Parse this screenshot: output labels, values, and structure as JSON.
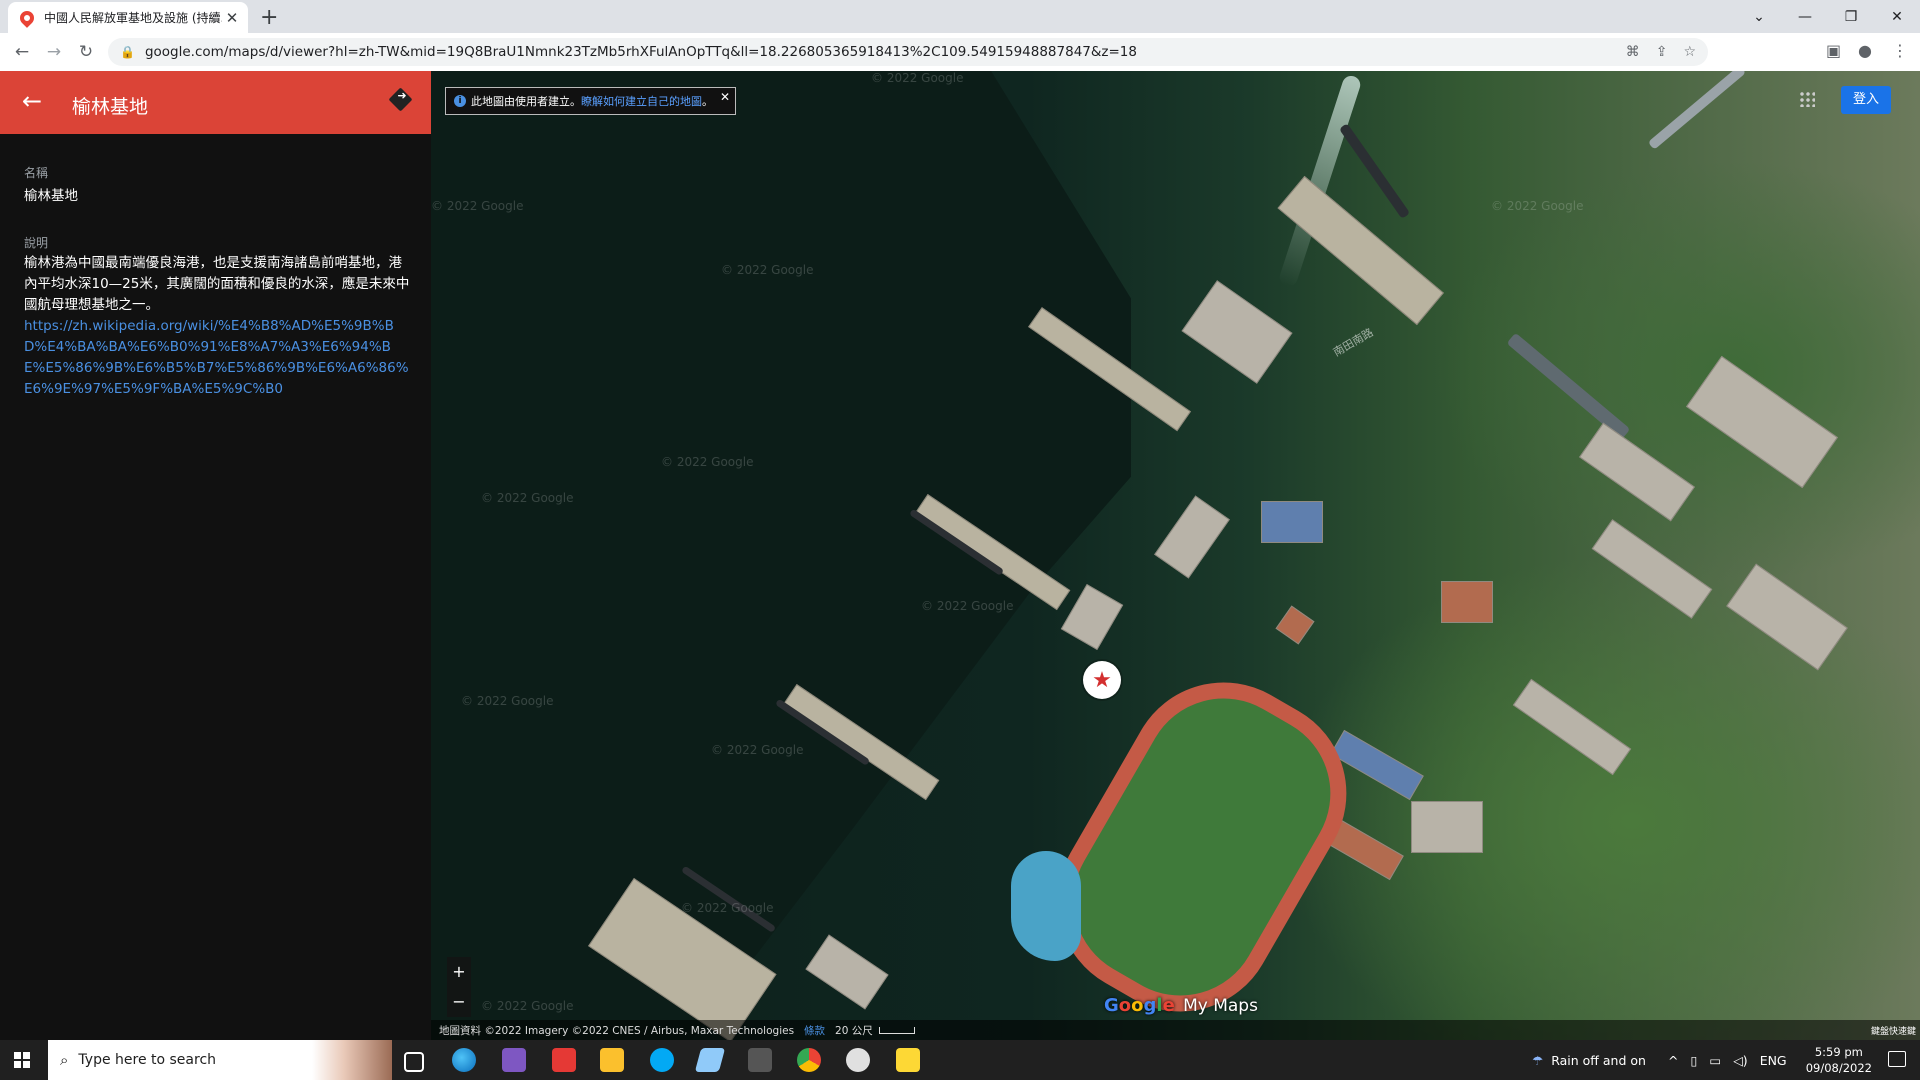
{
  "browser": {
    "tab_title": "中國人民解放軍基地及設施 (持續...",
    "url": "google.com/maps/d/viewer?hl=zh-TW&mid=19Q8BraU1Nmnk23TzMb5rhXFulAnOpTTq&ll=18.226805365918413%2C109.54915948887847&z=18",
    "new_tab_icon": "plus",
    "window_controls": [
      "chevron-down",
      "minimize",
      "restore",
      "close"
    ]
  },
  "panel": {
    "title": "榆林基地",
    "name_label": "名稱",
    "name_value": "榆林基地",
    "desc_label": "說明",
    "desc_text": "榆林港為中國最南端優良海港，也是支援南海諸島前哨基地，港內平均水深10—25米，其廣闊的面積和優良的水深，應是未來中國航母理想基地之一。",
    "desc_link": "https://zh.wikipedia.org/wiki/%E4%B8%AD%E5%9B%BD%E4%BA%BA%E6%B0%91%E8%A7%A3%E6%94%BE%E5%86%9B%E6%B5%B7%E5%86%9B%E6%A6%86%E6%9E%97%E5%9F%BA%E5%9C%B0"
  },
  "map": {
    "notice_text": "此地圖由使用者建立。",
    "notice_link": "瞭解如何建立自己的地圖",
    "notice_end": "。",
    "signin_label": "登入",
    "zoom_in": "+",
    "zoom_out": "−",
    "attribution": "地圖資料 ©2022 Imagery ©2022 CNES / Airbus, Maxar Technologies",
    "terms": "條款",
    "scale_label": "20 公尺",
    "brand_google": "Google",
    "brand_mymaps": "My Maps",
    "watermark": "© 2022 Google",
    "road_label": "南田南路",
    "corner_label": "鍵盤快速鍵",
    "marker_icon": "star"
  },
  "taskbar": {
    "search_placeholder": "Type here to search",
    "weather": "Rain off and on",
    "lang": "ENG",
    "time": "5:59 pm",
    "date": "09/08/2022"
  }
}
